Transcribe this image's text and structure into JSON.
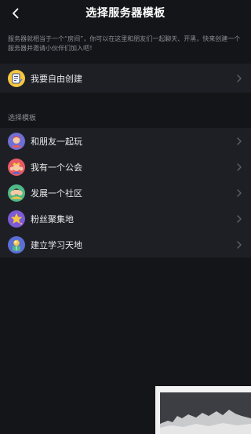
{
  "header": {
    "title": "选择服务器模板"
  },
  "description": "服务器就相当于一个“房间”，你可以在这里和朋友们一起聊天、开黑，快来创建一个服务器并邀请小伙伴们加入吧！",
  "create": {
    "label": "我要自由创建",
    "icon": "create-card-icon"
  },
  "templates": {
    "section_label": "选择模板",
    "items": [
      {
        "label": "和朋友一起玩",
        "icon": "friends-play-icon"
      },
      {
        "label": "我有一个公会",
        "icon": "guild-icon"
      },
      {
        "label": "发展一个社区",
        "icon": "community-icon"
      },
      {
        "label": "粉丝聚集地",
        "icon": "fan-star-icon"
      },
      {
        "label": "建立学习天地",
        "icon": "study-icon"
      }
    ]
  },
  "colors": {
    "background": "#141519",
    "card": "#1e1f24",
    "muted_text": "#8b8e94",
    "chevron": "#5e6168"
  }
}
